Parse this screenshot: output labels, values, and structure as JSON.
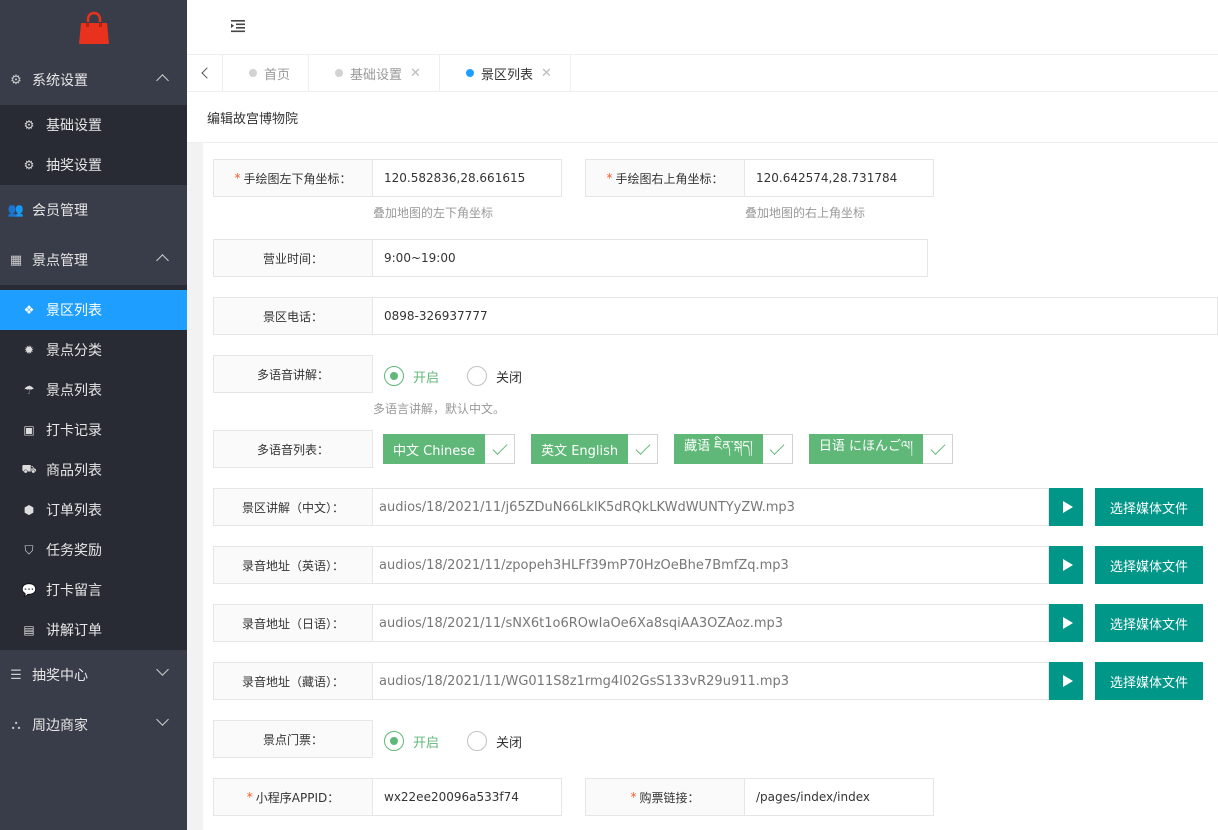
{
  "sidebar": {
    "groups": [
      {
        "label": "系统设置",
        "icon": "gears-icon",
        "children": [
          {
            "label": "基础设置",
            "icon": "gear-icon"
          },
          {
            "label": "抽奖设置",
            "icon": "gear-icon"
          }
        ]
      },
      {
        "label": "会员管理",
        "icon": "users-icon"
      },
      {
        "label": "景点管理",
        "icon": "grid-icon",
        "children": [
          {
            "label": "景区列表",
            "icon": "cubes-icon"
          },
          {
            "label": "景点分类",
            "icon": "cog-icon"
          },
          {
            "label": "景点列表",
            "icon": "umbrella-icon"
          },
          {
            "label": "打卡记录",
            "icon": "address-book-icon"
          },
          {
            "label": "商品列表",
            "icon": "truck-icon"
          },
          {
            "label": "订单列表",
            "icon": "cube-icon"
          },
          {
            "label": "任务奖励",
            "icon": "shield-icon"
          },
          {
            "label": "打卡留言",
            "icon": "comment-icon"
          },
          {
            "label": "讲解订单",
            "icon": "file-icon"
          }
        ]
      },
      {
        "label": "抽奖中心",
        "icon": "database-icon"
      },
      {
        "label": "周边商家",
        "icon": "sitemap-icon"
      }
    ]
  },
  "tabs": [
    {
      "label": "首页"
    },
    {
      "label": "基础设置"
    },
    {
      "label": "景区列表"
    }
  ],
  "page_title": "编辑故宫博物院",
  "form": {
    "bottom_left_label": "手绘图左下角坐标：",
    "bottom_left_value": "120.582836,28.661615",
    "bottom_left_hint": "叠加地图的左下角坐标",
    "top_right_label": "手绘图右上角坐标：",
    "top_right_value": "120.642574,28.731784",
    "top_right_hint": "叠加地图的右上角坐标",
    "hours_label": "营业时间：",
    "hours_value": "9:00~19:00",
    "phone_label": "景区电话：",
    "phone_value": "0898-326937777",
    "multilang_label": "多语音讲解：",
    "multilang_on": "开启",
    "multilang_off": "关闭",
    "multilang_hint": "多语言讲解，默认中文。",
    "langlist_label": "多语音列表：",
    "languages": [
      "中文 Chinese",
      "英文 English",
      "藏语 ཇིན་སྐད།",
      "日语 にほんごལ།"
    ],
    "audio_rows": [
      {
        "label": "景区讲解（中文）：",
        "value": "audios/18/2021/11/j65ZDuN66LklK5dRQkLKWdWUNTYyZW.mp3"
      },
      {
        "label": "录音地址（英语）：",
        "value": "audios/18/2021/11/zpopeh3HLFf39mP70HzOeBhe7BmfZq.mp3"
      },
      {
        "label": "录音地址（日语）：",
        "value": "audios/18/2021/11/sNX6t1o6ROwIaOe6Xa8sqiAA3OZAoz.mp3"
      },
      {
        "label": "录音地址（藏语）：",
        "value": "audios/18/2021/11/WG011S8z1rmg4I02GsS133vR29u911.mp3"
      }
    ],
    "media_button": "选择媒体文件",
    "ticket_label": "景点门票：",
    "ticket_on": "开启",
    "ticket_off": "关闭",
    "appid_label": "小程序APPID：",
    "appid_value": "wx22ee20096a533f74",
    "buy_label": "购票链接：",
    "buy_value": "/pages/index/index"
  },
  "colors": {
    "sidebar_bg": "#393d49",
    "active": "#1e9fff",
    "teal": "#009688",
    "green": "#5fb878"
  }
}
